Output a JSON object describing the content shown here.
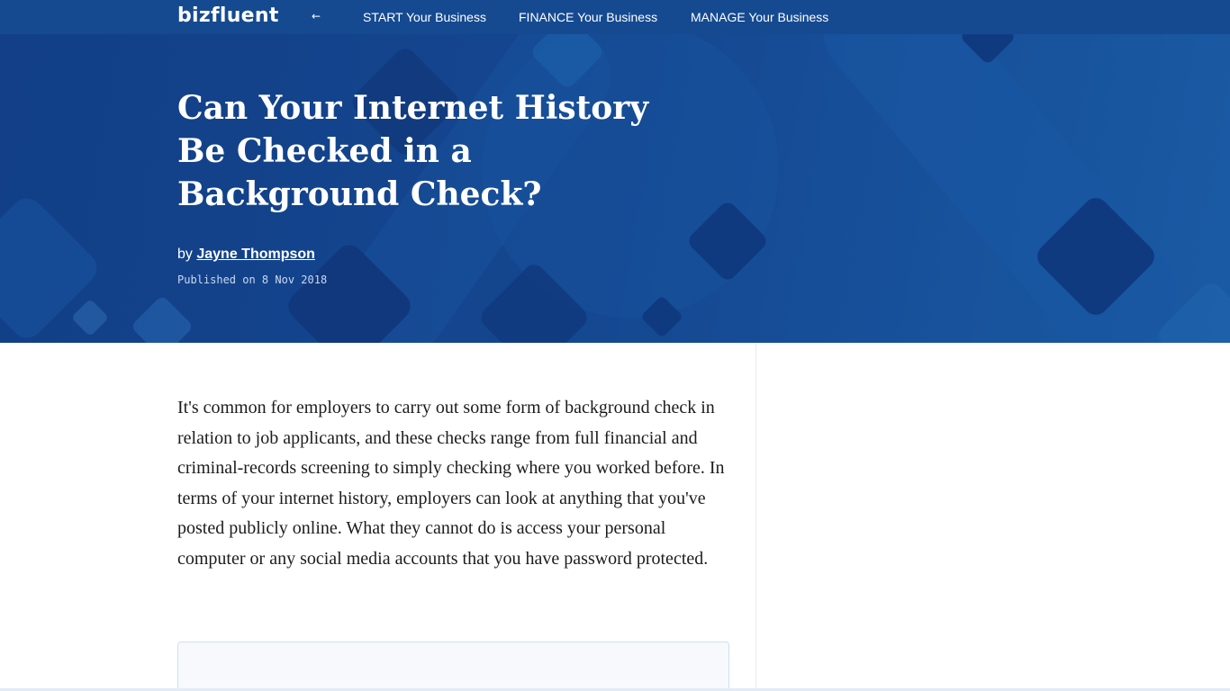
{
  "nav": {
    "logo": "bizfluent",
    "back_icon": "arrow-left-icon",
    "back_glyph": "←",
    "links": [
      "START Your Business",
      "FINANCE Your Business",
      "MANAGE Your Business"
    ]
  },
  "article": {
    "title": "Can Your Internet History Be Checked in a Background Check?",
    "by_prefix": "by",
    "author": "Jayne Thompson",
    "published": "Published on 8 Nov 2018",
    "intro": "It's common for employers to carry out some form of background check in relation to job applicants, and these checks range from full financial and criminal-records screening to simply checking where you worked before. In terms of your internet history, employers can look at anything that you've posted publicly online. What they cannot do is access your personal computer or any social media accounts that you have password protected."
  },
  "colors": {
    "nav_bg": "#154a91",
    "hero_bg": "#14468f",
    "accent_shape": "#0f3a80"
  }
}
